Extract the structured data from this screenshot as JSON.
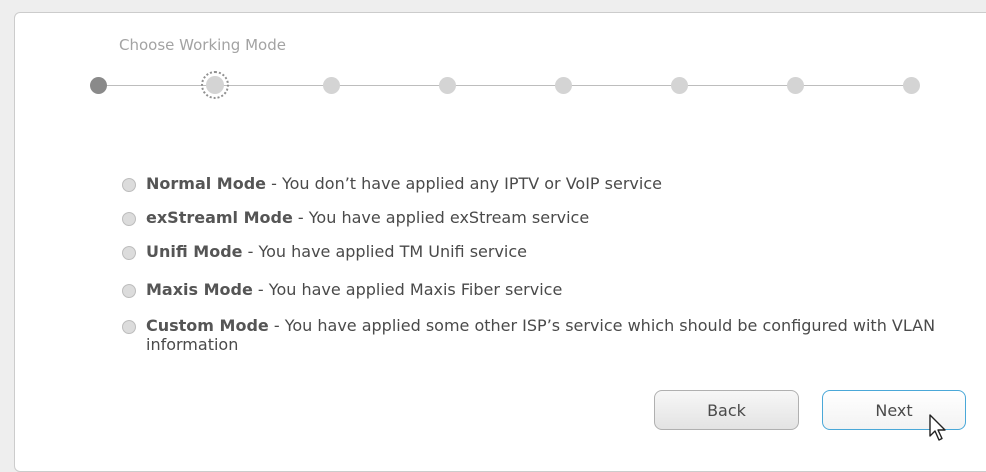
{
  "wizard": {
    "step_title": "Choose Working Mode",
    "total_steps": 8,
    "current_step": 2
  },
  "options": [
    {
      "name": "Normal Mode",
      "desc": " - You don’t have applied any IPTV or VoIP service"
    },
    {
      "name": "exStreaml Mode",
      "desc": " - You have applied exStream service"
    },
    {
      "name": "Unifi Mode",
      "desc": " - You have applied TM Unifi service"
    },
    {
      "name": "Maxis Mode",
      "desc": " - You have applied Maxis Fiber service"
    },
    {
      "name": "Custom Mode",
      "desc": " - You have applied some other ISP’s service which should be configured with VLAN information"
    }
  ],
  "buttons": {
    "back_label": "Back",
    "next_label": "Next"
  },
  "icons": {
    "cursor": "mouse-pointer-icon"
  }
}
